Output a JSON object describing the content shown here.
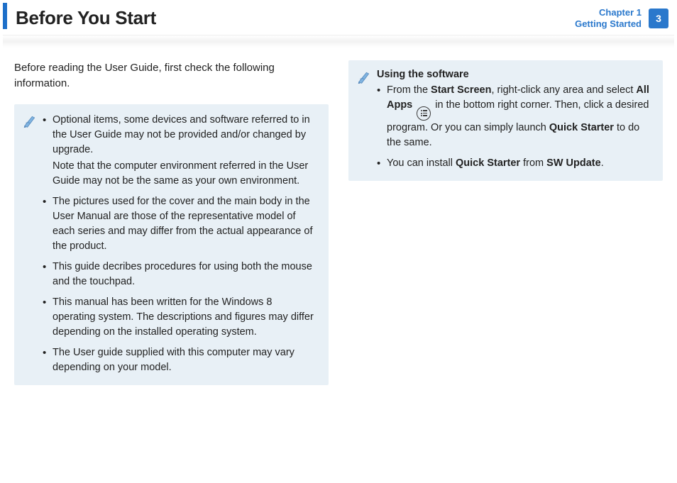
{
  "header": {
    "title": "Before You Start",
    "chapter_line1": "Chapter 1",
    "chapter_line2": "Getting Started",
    "page_number": "3"
  },
  "left": {
    "intro": "Before reading the User Guide, first check the following information.",
    "bullets": {
      "b1a": "Optional items, some devices and software referred to in the User Guide may not be provided and/or changed by upgrade.",
      "b1b": "Note that the computer environment referred in the User Guide may not be the same as your own environment.",
      "b2": "The pictures used for the cover and the main body in the User Manual are those of the representative model of each series and may differ from the actual appearance of the product.",
      "b3": "This guide decribes procedures for using both the mouse and the touchpad.",
      "b4": "This manual has been written for the Windows 8 operating system. The descriptions and figures may differ depending on the installed operating system.",
      "b5": "The User guide supplied with this computer may vary depending on your model."
    }
  },
  "right": {
    "heading": "Using the software",
    "b1": {
      "t1": "From the ",
      "t2": "Start Screen",
      "t3": ", right-click any area and select ",
      "t4": "All Apps",
      "t5": " in the bottom right corner. Then, click a desired program. Or you can simply launch ",
      "t6": "Quick Starter",
      "t7": " to do the same."
    },
    "b2": {
      "t1": "You can install ",
      "t2": "Quick Starter",
      "t3": " from ",
      "t4": "SW Update",
      "t5": "."
    }
  }
}
